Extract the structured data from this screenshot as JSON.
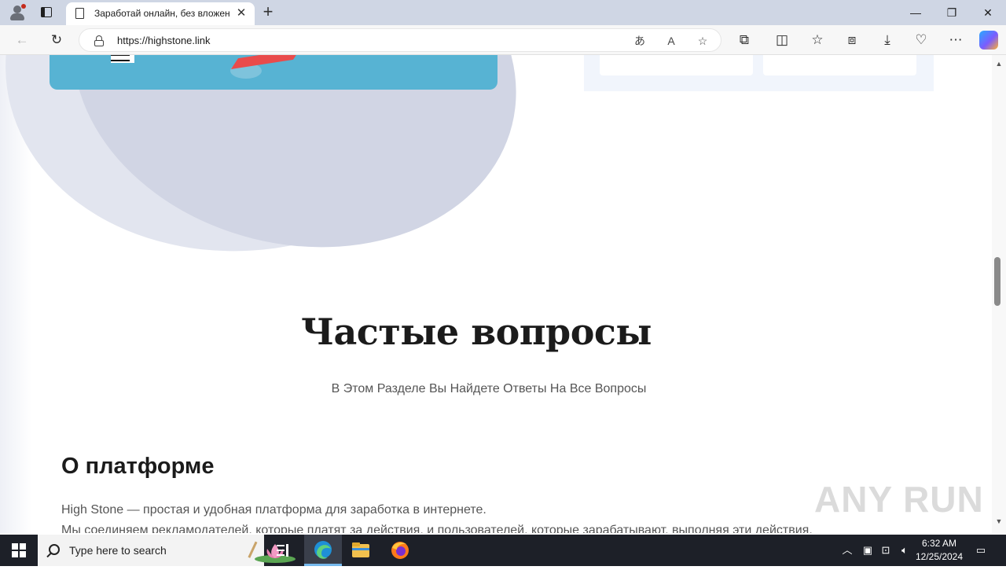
{
  "browser": {
    "tab_title": "Заработай онлайн, без вложений",
    "url": "https://highstone.link",
    "new_tab_symbol": "+",
    "close_tab_symbol": "✕",
    "window_controls": {
      "minimize": "—",
      "restore": "❐",
      "close": "✕"
    }
  },
  "page": {
    "faq_title": "Частые вопросы",
    "faq_subtitle": "В Этом Разделе Вы Найдете Ответы На Все Вопросы",
    "section_title": "О платформе",
    "paragraph_1": "High Stone — простая и удобная платформа для заработка в интернете.",
    "paragraph_2": "Мы соединяем рекламодателей, которые платят за действия, и пользователей, которые зарабатывают, выполняя эти действия."
  },
  "watermark": "ANY RUN",
  "taskbar": {
    "search_placeholder": "Type here to search",
    "time": "6:32 AM",
    "date": "12/25/2024"
  },
  "colors": {
    "tabstrip": "#cfd6e4",
    "hero_blue": "#57b3d3",
    "blob_light": "#e2e5ef",
    "blob_dark": "#d1d5e4",
    "taskbar": "#1d2028",
    "accent": "#76b9ed"
  }
}
